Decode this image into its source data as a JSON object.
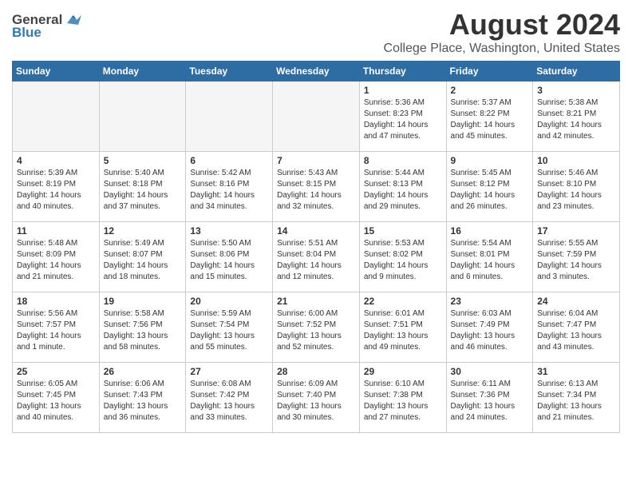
{
  "header": {
    "logo_general": "General",
    "logo_blue": "Blue",
    "main_title": "August 2024",
    "subtitle": "College Place, Washington, United States"
  },
  "weekdays": [
    "Sunday",
    "Monday",
    "Tuesday",
    "Wednesday",
    "Thursday",
    "Friday",
    "Saturday"
  ],
  "weeks": [
    [
      {
        "day": "",
        "info": ""
      },
      {
        "day": "",
        "info": ""
      },
      {
        "day": "",
        "info": ""
      },
      {
        "day": "",
        "info": ""
      },
      {
        "day": "1",
        "info": "Sunrise: 5:36 AM\nSunset: 8:23 PM\nDaylight: 14 hours\nand 47 minutes."
      },
      {
        "day": "2",
        "info": "Sunrise: 5:37 AM\nSunset: 8:22 PM\nDaylight: 14 hours\nand 45 minutes."
      },
      {
        "day": "3",
        "info": "Sunrise: 5:38 AM\nSunset: 8:21 PM\nDaylight: 14 hours\nand 42 minutes."
      }
    ],
    [
      {
        "day": "4",
        "info": "Sunrise: 5:39 AM\nSunset: 8:19 PM\nDaylight: 14 hours\nand 40 minutes."
      },
      {
        "day": "5",
        "info": "Sunrise: 5:40 AM\nSunset: 8:18 PM\nDaylight: 14 hours\nand 37 minutes."
      },
      {
        "day": "6",
        "info": "Sunrise: 5:42 AM\nSunset: 8:16 PM\nDaylight: 14 hours\nand 34 minutes."
      },
      {
        "day": "7",
        "info": "Sunrise: 5:43 AM\nSunset: 8:15 PM\nDaylight: 14 hours\nand 32 minutes."
      },
      {
        "day": "8",
        "info": "Sunrise: 5:44 AM\nSunset: 8:13 PM\nDaylight: 14 hours\nand 29 minutes."
      },
      {
        "day": "9",
        "info": "Sunrise: 5:45 AM\nSunset: 8:12 PM\nDaylight: 14 hours\nand 26 minutes."
      },
      {
        "day": "10",
        "info": "Sunrise: 5:46 AM\nSunset: 8:10 PM\nDaylight: 14 hours\nand 23 minutes."
      }
    ],
    [
      {
        "day": "11",
        "info": "Sunrise: 5:48 AM\nSunset: 8:09 PM\nDaylight: 14 hours\nand 21 minutes."
      },
      {
        "day": "12",
        "info": "Sunrise: 5:49 AM\nSunset: 8:07 PM\nDaylight: 14 hours\nand 18 minutes."
      },
      {
        "day": "13",
        "info": "Sunrise: 5:50 AM\nSunset: 8:06 PM\nDaylight: 14 hours\nand 15 minutes."
      },
      {
        "day": "14",
        "info": "Sunrise: 5:51 AM\nSunset: 8:04 PM\nDaylight: 14 hours\nand 12 minutes."
      },
      {
        "day": "15",
        "info": "Sunrise: 5:53 AM\nSunset: 8:02 PM\nDaylight: 14 hours\nand 9 minutes."
      },
      {
        "day": "16",
        "info": "Sunrise: 5:54 AM\nSunset: 8:01 PM\nDaylight: 14 hours\nand 6 minutes."
      },
      {
        "day": "17",
        "info": "Sunrise: 5:55 AM\nSunset: 7:59 PM\nDaylight: 14 hours\nand 3 minutes."
      }
    ],
    [
      {
        "day": "18",
        "info": "Sunrise: 5:56 AM\nSunset: 7:57 PM\nDaylight: 14 hours\nand 1 minute."
      },
      {
        "day": "19",
        "info": "Sunrise: 5:58 AM\nSunset: 7:56 PM\nDaylight: 13 hours\nand 58 minutes."
      },
      {
        "day": "20",
        "info": "Sunrise: 5:59 AM\nSunset: 7:54 PM\nDaylight: 13 hours\nand 55 minutes."
      },
      {
        "day": "21",
        "info": "Sunrise: 6:00 AM\nSunset: 7:52 PM\nDaylight: 13 hours\nand 52 minutes."
      },
      {
        "day": "22",
        "info": "Sunrise: 6:01 AM\nSunset: 7:51 PM\nDaylight: 13 hours\nand 49 minutes."
      },
      {
        "day": "23",
        "info": "Sunrise: 6:03 AM\nSunset: 7:49 PM\nDaylight: 13 hours\nand 46 minutes."
      },
      {
        "day": "24",
        "info": "Sunrise: 6:04 AM\nSunset: 7:47 PM\nDaylight: 13 hours\nand 43 minutes."
      }
    ],
    [
      {
        "day": "25",
        "info": "Sunrise: 6:05 AM\nSunset: 7:45 PM\nDaylight: 13 hours\nand 40 minutes."
      },
      {
        "day": "26",
        "info": "Sunrise: 6:06 AM\nSunset: 7:43 PM\nDaylight: 13 hours\nand 36 minutes."
      },
      {
        "day": "27",
        "info": "Sunrise: 6:08 AM\nSunset: 7:42 PM\nDaylight: 13 hours\nand 33 minutes."
      },
      {
        "day": "28",
        "info": "Sunrise: 6:09 AM\nSunset: 7:40 PM\nDaylight: 13 hours\nand 30 minutes."
      },
      {
        "day": "29",
        "info": "Sunrise: 6:10 AM\nSunset: 7:38 PM\nDaylight: 13 hours\nand 27 minutes."
      },
      {
        "day": "30",
        "info": "Sunrise: 6:11 AM\nSunset: 7:36 PM\nDaylight: 13 hours\nand 24 minutes."
      },
      {
        "day": "31",
        "info": "Sunrise: 6:13 AM\nSunset: 7:34 PM\nDaylight: 13 hours\nand 21 minutes."
      }
    ]
  ]
}
